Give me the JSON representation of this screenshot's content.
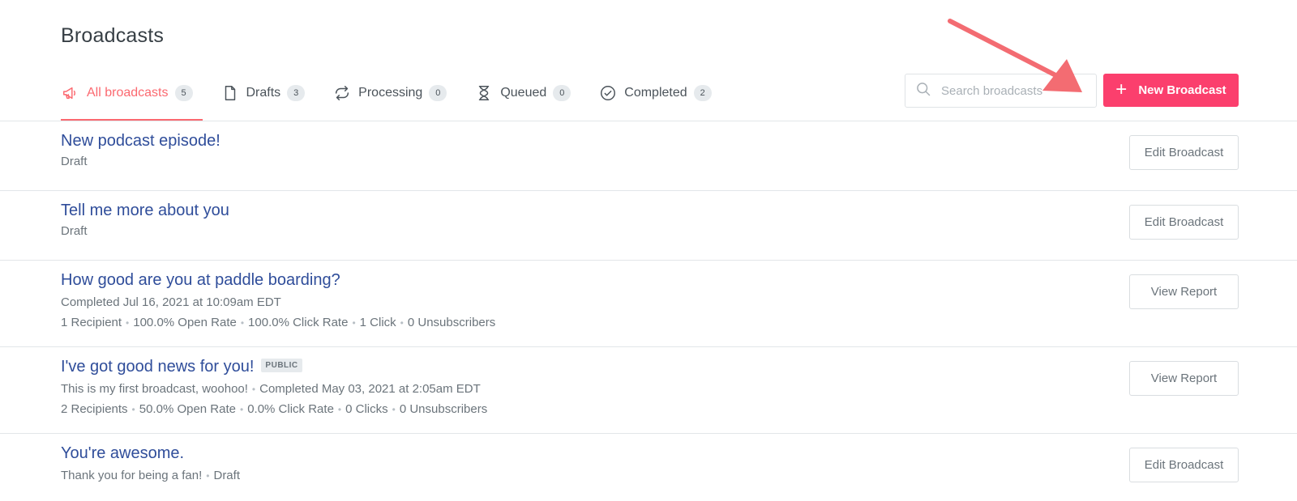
{
  "page": {
    "title": "Broadcasts"
  },
  "tabs": [
    {
      "label": "All broadcasts",
      "count": "5",
      "icon": "megaphone-icon",
      "active": true
    },
    {
      "label": "Drafts",
      "count": "3",
      "icon": "document-icon",
      "active": false
    },
    {
      "label": "Processing",
      "count": "0",
      "icon": "refresh-icon",
      "active": false
    },
    {
      "label": "Queued",
      "count": "0",
      "icon": "hourglass-icon",
      "active": false
    },
    {
      "label": "Completed",
      "count": "2",
      "icon": "check-circle-icon",
      "active": false
    }
  ],
  "search": {
    "placeholder": "Search broadcasts",
    "icon": "search-icon"
  },
  "new_button": {
    "label": "New Broadcast",
    "icon": "plus-icon",
    "color": "#fb3f6d"
  },
  "annotation": {
    "icon": "arrow-icon",
    "color": "#f36c72"
  },
  "broadcasts": [
    {
      "title": "New podcast episode!",
      "meta1": [
        "Draft"
      ],
      "meta2": [],
      "action": "Edit Broadcast"
    },
    {
      "title": "Tell me more about you",
      "meta1": [
        "Draft"
      ],
      "meta2": [],
      "action": "Edit Broadcast"
    },
    {
      "title": "How good are you at paddle boarding?",
      "meta1": [
        "Completed Jul 16, 2021 at 10:09am EDT"
      ],
      "meta2": [
        "1 Recipient",
        "100.0% Open Rate",
        "100.0% Click Rate",
        "1 Click",
        "0 Unsubscribers"
      ],
      "action": "View Report"
    },
    {
      "title": "I've got good news for you!",
      "badge": "PUBLIC",
      "meta1": [
        "This is my first broadcast, woohoo!",
        "Completed May 03, 2021 at 2:05am EDT"
      ],
      "meta2": [
        "2 Recipients",
        "50.0% Open Rate",
        "0.0% Click Rate",
        "0 Clicks",
        "0 Unsubscribers"
      ],
      "action": "View Report"
    },
    {
      "title": "You're awesome.",
      "meta1": [
        "Thank you for being a fan!",
        "Draft"
      ],
      "meta2": [],
      "action": "Edit Broadcast"
    }
  ]
}
